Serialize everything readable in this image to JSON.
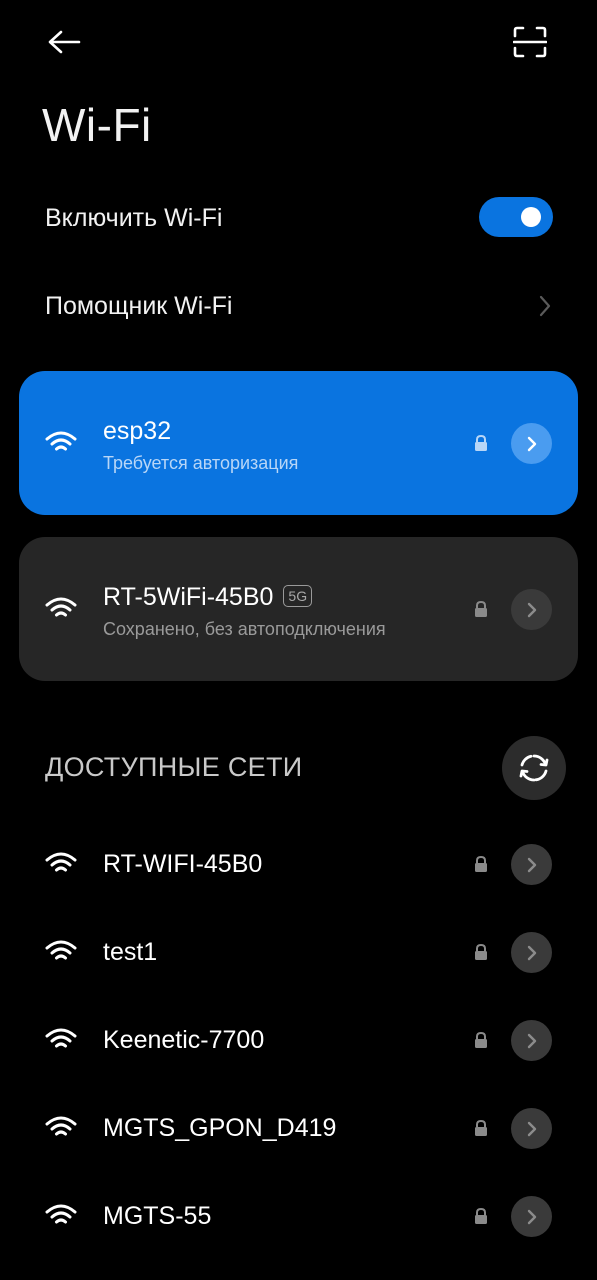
{
  "header": {
    "back_icon": "arrow-left-icon",
    "scan_icon": "qr-scan-icon",
    "title": "Wi-Fi"
  },
  "settings": {
    "enable_wifi_label": "Включить Wi-Fi",
    "enable_wifi_on": true,
    "assistant_label": "Помощник Wi-Fi"
  },
  "connected": [
    {
      "name": "esp32",
      "status": "Требуется авторизация",
      "badge": "",
      "secured": true,
      "active": true
    },
    {
      "name": "RT-5WiFi-45B0",
      "status": "Сохранено, без автоподключения",
      "badge": "5G",
      "secured": true,
      "active": false
    }
  ],
  "available": {
    "header": "ДОСТУПНЫЕ СЕТИ",
    "refresh_icon": "refresh-icon",
    "networks": [
      {
        "name": "RT-WIFI-45B0",
        "secured": true
      },
      {
        "name": "test1",
        "secured": true
      },
      {
        "name": "Keenetic-7700",
        "secured": true
      },
      {
        "name": "MGTS_GPON_D419",
        "secured": true
      },
      {
        "name": "MGTS-55",
        "secured": true
      }
    ]
  },
  "colors": {
    "background": "#000000",
    "accent": "#0a74e0",
    "card_dark": "#262626",
    "chevron_btn_dark": "#3a3a3a",
    "chevron_btn_on_accent": "#4a9cf0",
    "subtext_on_accent": "#b8d6f7",
    "subtext_dark": "#9a9a9a"
  }
}
